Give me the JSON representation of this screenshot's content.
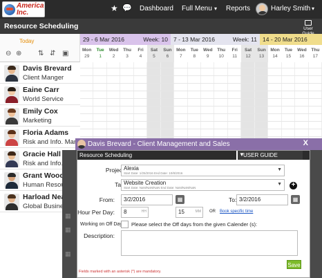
{
  "app": {
    "logo_text": "America\nInc.",
    "nav": {
      "dashboard": "Dashboard",
      "full_menu": "Full Menu",
      "reports": "Reports",
      "user_name": "Harley Smith"
    },
    "dropdown_caret": "▾"
  },
  "page": {
    "title": "Resource Scheduling",
    "user_guide": "User Guide",
    "today": "Today"
  },
  "calendar": {
    "weeks": [
      {
        "range": "29 - 6 Mar 2016",
        "week": "Week: 10",
        "color": "#d9c3eb"
      },
      {
        "range": "7 - 13 Mar 2016",
        "week": "Week: 11",
        "color": "#e4e4ef"
      },
      {
        "range": "14 - 20 Mar 2016",
        "week": "",
        "color": "#f0dd8c"
      }
    ],
    "day_names": [
      "Mon",
      "Tue",
      "Wed",
      "Thu",
      "Fri",
      "Sat",
      "Sun",
      "Mon",
      "Tue",
      "Wed",
      "Thu",
      "Fri",
      "Sat",
      "Sun",
      "Mon",
      "Tue",
      "Wed",
      "Thu"
    ],
    "day_nums": [
      "29",
      "1",
      "2",
      "3",
      "4",
      "5",
      "6",
      "7",
      "8",
      "9",
      "10",
      "11",
      "12",
      "13",
      "14",
      "15",
      "16",
      "17"
    ]
  },
  "employees": [
    {
      "name": "Davis Brevard",
      "role": "Client Manger"
    },
    {
      "name": "Eaine Carr",
      "role": "World Service"
    },
    {
      "name": "Emily Cox",
      "role": "Marketing"
    },
    {
      "name": "Floria Adams",
      "role": "Risk and Info. Mang"
    },
    {
      "name": "Gracie Hall",
      "role": "Risk and Info. Ma"
    },
    {
      "name": "Grant Wood",
      "role": "Human Resour"
    },
    {
      "name": "Harload Nea",
      "role": "Global Busines"
    }
  ],
  "modal": {
    "title": "Davis Brevard - Client Management and Sales",
    "close": "X",
    "section": "Resource Scheduling",
    "user_guide": "USER GUIDE",
    "projects_label": "Projects:",
    "project_value": "Alexia",
    "project_sub": "Start Date: 1/25/2016    End Date: 10/8/2016",
    "task_label": "Task:",
    "task_value": "Website Creation",
    "task_sub": "Start Date: NaN/NaN/NaN    End Date: NaN/NaN/NaN",
    "from_label": "From:",
    "from_value": "3/2/2016",
    "to_label": "To:",
    "to_value": "3/2/2016",
    "hours_label": "Hour Per Day:",
    "hours_value": "8",
    "hours_unit": "HH",
    "minutes_value": "15",
    "minutes_unit": "MM",
    "or_text": "OR",
    "book_link": "Book specific time",
    "offdays_label": "Working on Off Days",
    "offdays_hint": "Please select the Off days from the given Calender (s):",
    "description_label": "Description:",
    "mandatory_note": "Fields marked with an asterisk (*) are mandatory.",
    "save_label": "Save"
  }
}
